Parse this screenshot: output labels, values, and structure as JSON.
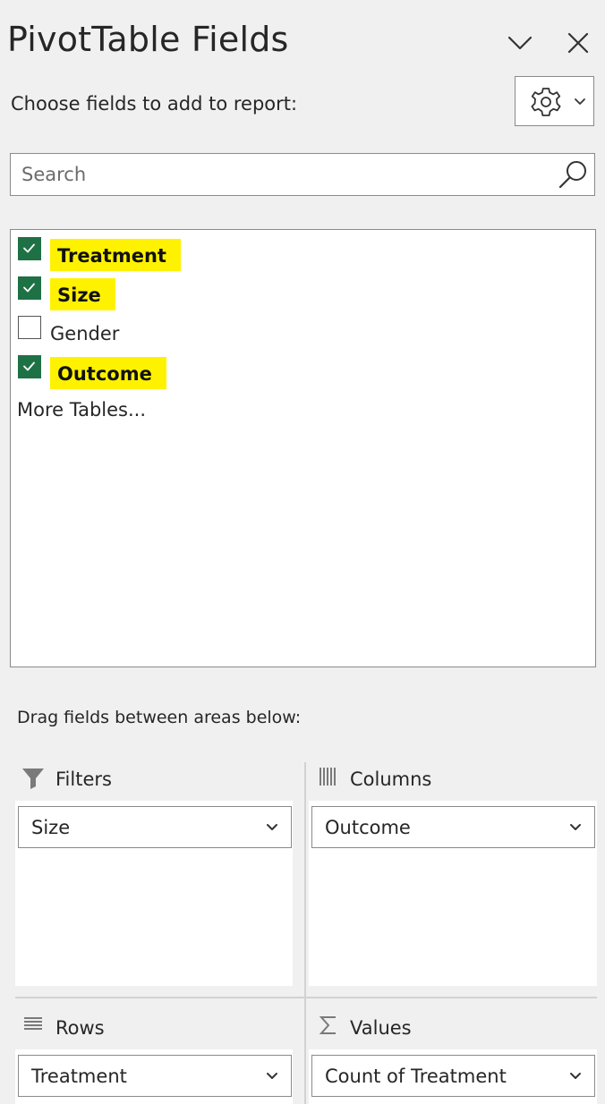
{
  "panel": {
    "title": "PivotTable Fields",
    "choose_label": "Choose fields to add to report:",
    "collapse_icon": "chevron-down-icon",
    "close_icon": "close-icon",
    "settings_icon": "gear-icon"
  },
  "search": {
    "placeholder": "Search",
    "value": ""
  },
  "fields": [
    {
      "label": "Treatment",
      "checked": true,
      "highlighted": true
    },
    {
      "label": "Size",
      "checked": true,
      "highlighted": true
    },
    {
      "label": "Gender",
      "checked": false,
      "highlighted": false
    },
    {
      "label": "Outcome",
      "checked": true,
      "highlighted": true
    }
  ],
  "more_tables": "More Tables...",
  "drag_label": "Drag fields between areas below:",
  "areas": {
    "filters": {
      "label": "Filters",
      "icon": "filter-icon",
      "items": [
        "Size"
      ]
    },
    "columns": {
      "label": "Columns",
      "icon": "columns-icon",
      "items": [
        "Outcome"
      ]
    },
    "rows": {
      "label": "Rows",
      "icon": "rows-icon",
      "items": [
        "Treatment"
      ]
    },
    "values": {
      "label": "Values",
      "icon": "sigma-icon",
      "items": [
        "Count of Treatment"
      ]
    }
  },
  "colors": {
    "checkbox_checked": "#1e7145",
    "highlight": "#fff200",
    "background": "#f0f0f0"
  }
}
